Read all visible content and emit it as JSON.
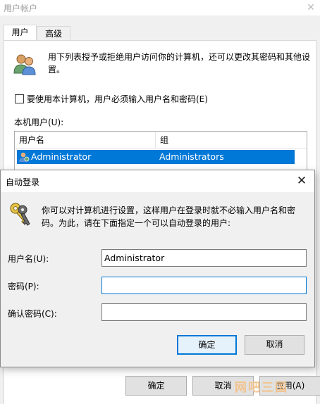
{
  "user_accounts": {
    "title": "用户帐户",
    "tabs": [
      {
        "label": "用户",
        "active": true
      },
      {
        "label": "高级",
        "active": false
      }
    ],
    "intro_text": "用下列表授予或拒绝用户访问你的计算机，还可以更改其密码和其他设置。",
    "require_login_checkbox": {
      "label": "要使用本计算机，用户必须输入用户名和密码(E)",
      "checked": false
    },
    "local_users_label": "本机用户(U):",
    "table": {
      "columns": [
        "用户名",
        "组"
      ],
      "rows": [
        {
          "user": "Administrator",
          "group": "Administrators",
          "selected": true
        }
      ]
    },
    "buttons": {
      "ok": "确定",
      "cancel": "取消",
      "apply": "应用(A)"
    },
    "watermark": "网吧三国"
  },
  "auto_login": {
    "title": "自动登录",
    "intro_text": "你可以对计算机进行设置，这样用户在登录时就不必输入用户名和密码。为此，请在下面指定一个可以自动登录的用户:",
    "username_label": "用户名(U):",
    "username_value": "Administrator",
    "password_label": "密码(P):",
    "password_value": "",
    "confirm_label": "确认密码(C):",
    "confirm_value": "",
    "buttons": {
      "ok": "确定",
      "cancel": "取消"
    }
  },
  "colors": {
    "selection": "#0078d7",
    "focus_border": "#0078d7",
    "window_bg": "#f0f0f0",
    "button_bg": "#e1e1e1"
  }
}
